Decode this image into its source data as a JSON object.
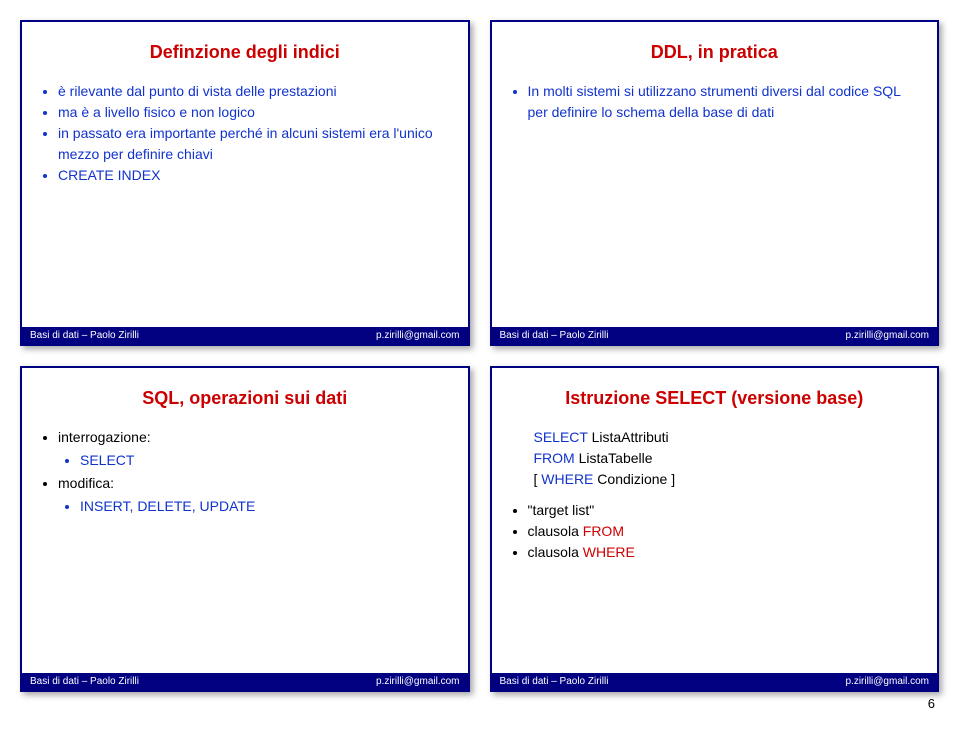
{
  "footer": {
    "left": "Basi di dati – Paolo Zirilli",
    "right": "p.zirilli@gmail.com"
  },
  "page_number": "6",
  "slides": {
    "tl": {
      "title": "Definzione degli indici",
      "b1": "è rilevante dal punto di vista delle prestazioni",
      "b2": "ma è a livello fisico e non logico",
      "b3": "in passato era importante perché in alcuni sistemi era l'unico mezzo per definire chiavi",
      "b4": "CREATE INDEX"
    },
    "tr": {
      "title": "DDL, in pratica",
      "b1": "In molti sistemi si utilizzano strumenti diversi dal codice SQL per definire lo schema della base di dati"
    },
    "bl": {
      "title": "SQL, operazioni sui dati",
      "b1": "interrogazione:",
      "b1a": "SELECT",
      "b2": "modifica:",
      "b2a": "INSERT, DELETE, UPDATE"
    },
    "br": {
      "title": "Istruzione SELECT (versione base)",
      "sel_kw": "SELECT",
      "sel_arg": "ListaAttributi",
      "from_kw": "FROM",
      "from_arg": "ListaTabelle",
      "where_open": "[ ",
      "where_kw": "WHERE",
      "where_arg": " Condizione ]",
      "b1": "\"target list\"",
      "b2_pre": "clausola ",
      "b2_kw": "FROM",
      "b3_pre": "clausola ",
      "b3_kw": "WHERE"
    }
  }
}
